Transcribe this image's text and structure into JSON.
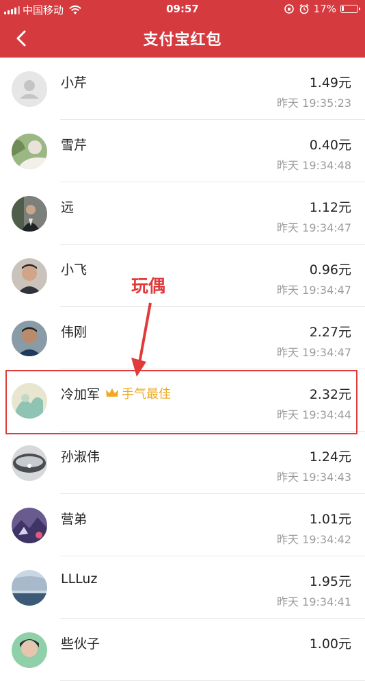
{
  "status_bar": {
    "carrier": "中国移动",
    "time": "09:57",
    "battery": "17%",
    "battery_level": 0.17
  },
  "header": {
    "title": "支付宝红包",
    "background": "#d53a3f"
  },
  "annotation": {
    "label": "玩偶",
    "color": "#e03a3a"
  },
  "best_badge_color": "#f0a920",
  "records": [
    {
      "name": "小芹",
      "amount": "1.49元",
      "time": "昨天 19:35:23"
    },
    {
      "name": "雪芹",
      "amount": "0.40元",
      "time": "昨天 19:34:48"
    },
    {
      "name": "远",
      "amount": "1.12元",
      "time": "昨天 19:34:47"
    },
    {
      "name": "小飞",
      "amount": "0.96元",
      "time": "昨天 19:34:47"
    },
    {
      "name": "伟刚",
      "amount": "2.27元",
      "time": "昨天 19:34:47"
    },
    {
      "name": "冷加军",
      "badge": "手气最佳",
      "amount": "2.32元",
      "time": "昨天 19:34:44"
    },
    {
      "name": "孙淑伟",
      "amount": "1.24元",
      "time": "昨天 19:34:43"
    },
    {
      "name": "营弟",
      "amount": "1.01元",
      "time": "昨天 19:34:42"
    },
    {
      "name": "LLLuz",
      "amount": "1.95元",
      "time": "昨天 19:34:41"
    },
    {
      "name": "些伙子",
      "amount": "1.00元",
      "time": ""
    }
  ]
}
